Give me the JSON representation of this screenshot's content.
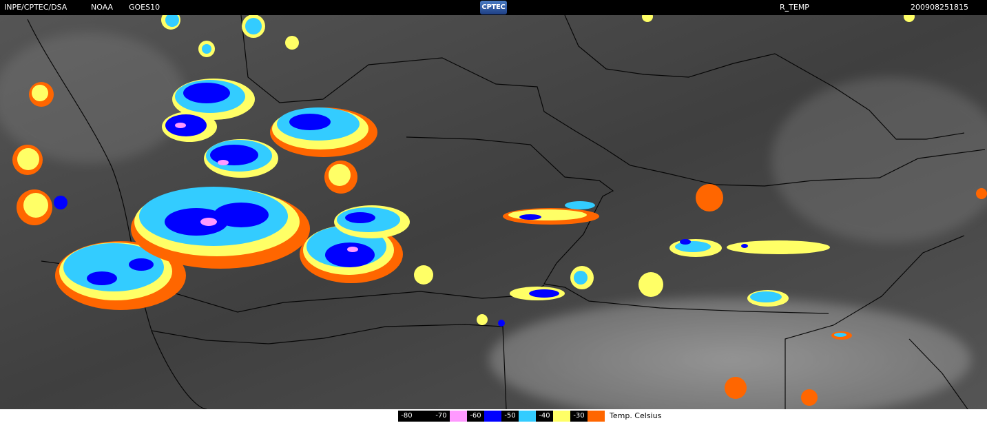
{
  "header": {
    "agency": "INPE/CPTEC/DSA",
    "organization": "NOAA",
    "satellite": "GOES10",
    "logo_text": "CPTEC",
    "product": "R_TEMP",
    "timestamp": "200908251815"
  },
  "legend": {
    "items": [
      {
        "label": "-80",
        "color": "#000000"
      },
      {
        "label": "-70",
        "color": "#ff99ff"
      },
      {
        "label": "-60",
        "color": "#0000ff"
      },
      {
        "label": "-50",
        "color": "#33ccff"
      },
      {
        "label": "-40",
        "color": "#ffff66"
      },
      {
        "label": "-30",
        "color": "#ff6600"
      }
    ],
    "unit": "Temp. Celsius"
  },
  "colors": {
    "background": "#000000",
    "border": "#000000"
  }
}
